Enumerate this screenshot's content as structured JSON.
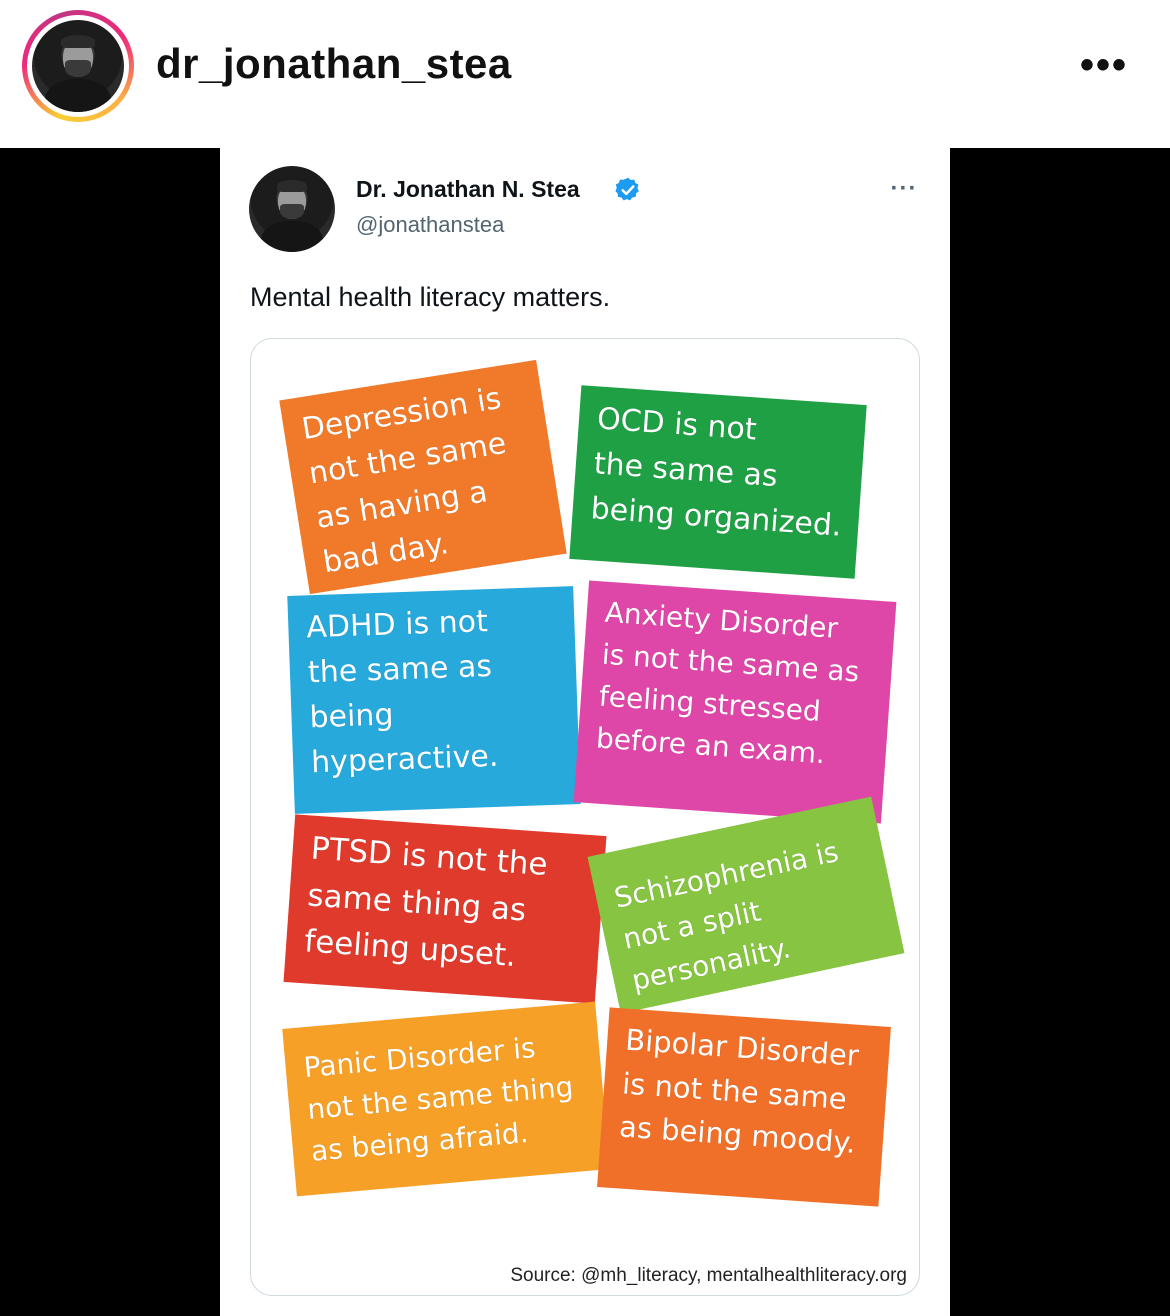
{
  "header": {
    "username": "dr_jonathan_stea",
    "more_glyph": "•••"
  },
  "tweet": {
    "display_name": "Dr. Jonathan N. Stea",
    "handle": "@jonathanstea",
    "more_glyph": "···",
    "text": "Mental health literacy matters.",
    "verified_color": "#1d9bf0"
  },
  "notes": [
    {
      "color": "#f07a2a",
      "lines": [
        "Depression is",
        "not the same",
        "as having a",
        "bad day."
      ]
    },
    {
      "color": "#1fa045",
      "lines": [
        "OCD is not",
        "the same as",
        "being organized."
      ]
    },
    {
      "color": "#27a9dc",
      "lines": [
        "ADHD is not",
        "the same as",
        "being",
        "hyperactive."
      ]
    },
    {
      "color": "#de47a8",
      "lines": [
        "Anxiety Disorder",
        "is not the same as",
        "feeling stressed",
        "before an exam."
      ]
    },
    {
      "color": "#e03a2c",
      "lines": [
        "PTSD is not the",
        "same thing as",
        "feeling upset."
      ]
    },
    {
      "color": "#86c442",
      "lines": [
        "Schizophrenia is",
        "not a split",
        "personality."
      ]
    },
    {
      "color": "#f6a027",
      "lines": [
        "Panic Disorder is",
        "not the same thing",
        "as being afraid."
      ]
    },
    {
      "color": "#f0702a",
      "lines": [
        "Bipolar Disorder",
        "is not the same",
        "as being moody."
      ]
    }
  ],
  "source": "Source: @mh_literacy, mentalhealthliteracy.org"
}
